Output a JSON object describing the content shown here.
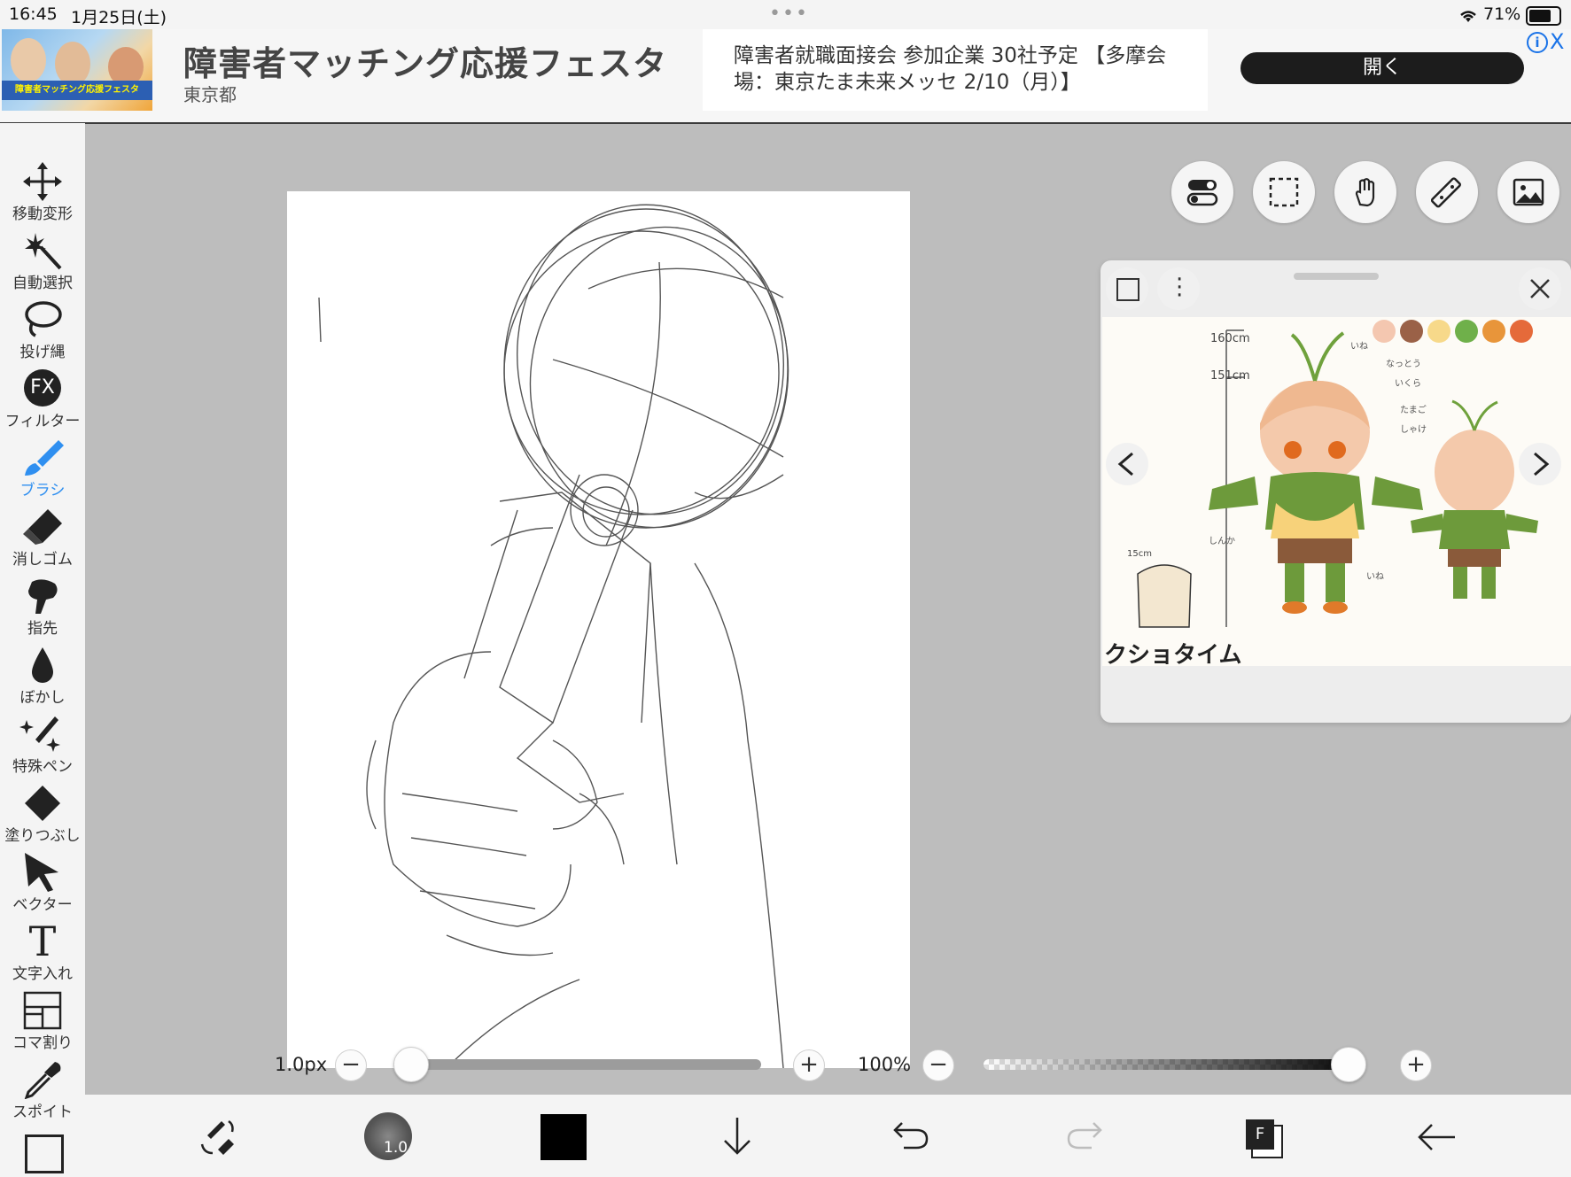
{
  "status_bar": {
    "time": "16:45",
    "date": "1月25日(土)",
    "battery": "71%"
  },
  "ad": {
    "thumb_banner_text": "障害者マッチング応援フェスタ",
    "title": "障害者マッチング応援フェスタ",
    "location": "東京都",
    "description": "障害者就職面接会 参加企業 30社予定 【多摩会場：東京たま未来メッセ 2/10（月）】",
    "open_button": "開く",
    "info_icon": "i",
    "close_icon": "X"
  },
  "toolbar": {
    "items": [
      {
        "label": "移動変形",
        "icon": "move-icon"
      },
      {
        "label": "自動選択",
        "icon": "magic-wand-icon"
      },
      {
        "label": "投げ縄",
        "icon": "lasso-icon"
      },
      {
        "label": "フィルター",
        "icon": "fx-icon",
        "icon_text": "FX"
      },
      {
        "label": "ブラシ",
        "icon": "brush-icon"
      },
      {
        "label": "消しゴム",
        "icon": "eraser-icon"
      },
      {
        "label": "指先",
        "icon": "finger-icon"
      },
      {
        "label": "ぼかし",
        "icon": "blur-drop-icon"
      },
      {
        "label": "特殊ペン",
        "icon": "special-pen-icon"
      },
      {
        "label": "塗りつぶし",
        "icon": "fill-icon"
      },
      {
        "label": "ベクター",
        "icon": "vector-icon"
      },
      {
        "label": "文字入れ",
        "icon": "text-icon",
        "icon_text": "T"
      },
      {
        "label": "コマ割り",
        "icon": "panel-split-icon"
      },
      {
        "label": "スポイト",
        "icon": "eyedropper-icon"
      }
    ],
    "active": "ブラシ"
  },
  "floating_buttons": [
    "toggle-icon",
    "selection-icon",
    "hand-icon",
    "ruler-icon",
    "image-icon"
  ],
  "reference_panel": {
    "swatch_colors": [
      "#f4c7b0",
      "#9a6147",
      "#f7d98a",
      "#6fb04a",
      "#e8953a",
      "#e56a3a"
    ],
    "labels": {
      "height_160": "160cm",
      "height_151": "151cm",
      "logo_text": "クショタイム",
      "size_15": "15cm"
    },
    "notes": [
      "いね",
      "なっとう",
      "いくら",
      "たまご",
      "しゃけ",
      "しんか",
      "いね"
    ]
  },
  "brush_slider": {
    "value_label": "1.0px",
    "minus": "−",
    "plus": "+",
    "value": 0.0
  },
  "opacity_slider": {
    "value_label": "100%",
    "minus": "−",
    "plus": "+",
    "value": 1.0
  },
  "bottom_bar": {
    "brush_size_label": "1.0",
    "color": "#000000",
    "layer_label": "F",
    "icons": [
      "swap-tools-icon",
      "brush-size-icon",
      "color-swatch",
      "download-icon",
      "undo-icon",
      "redo-icon",
      "layers-icon",
      "back-icon"
    ]
  }
}
